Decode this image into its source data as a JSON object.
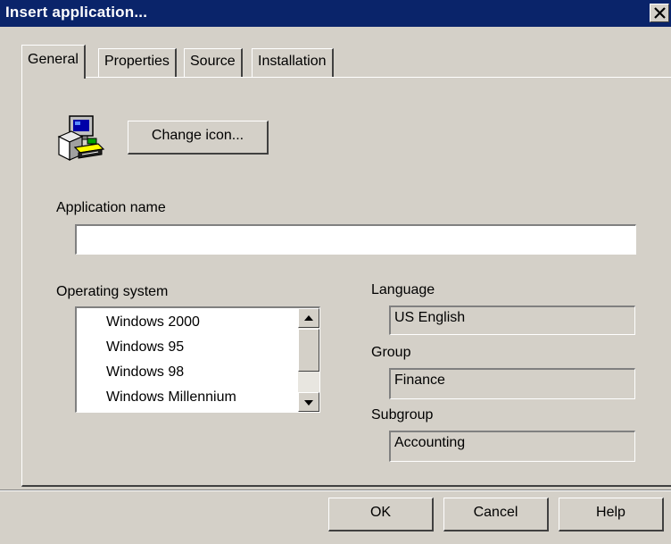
{
  "window": {
    "title": "Insert application...",
    "close_glyph": "✕"
  },
  "tabs": [
    {
      "label": "General",
      "active": true
    },
    {
      "label": "Properties",
      "active": false
    },
    {
      "label": "Source",
      "active": false
    },
    {
      "label": "Installation",
      "active": false
    }
  ],
  "general": {
    "icon": "computer-installer-icon",
    "change_icon_label": "Change icon...",
    "application_name_label": "Application name",
    "application_name_value": "",
    "operating_system_label": "Operating system",
    "operating_systems": [
      "Windows 2000",
      "Windows 95",
      "Windows 98",
      "Windows Millennium"
    ],
    "language_label": "Language",
    "language_value": "US English",
    "group_label": "Group",
    "group_value": "Finance",
    "subgroup_label": "Subgroup",
    "subgroup_value": "Accounting"
  },
  "buttons": {
    "ok": "OK",
    "cancel": "Cancel",
    "help": "Help"
  },
  "colors": {
    "title_bar": "#0a246a",
    "dialog_face": "#d4d0c8"
  }
}
